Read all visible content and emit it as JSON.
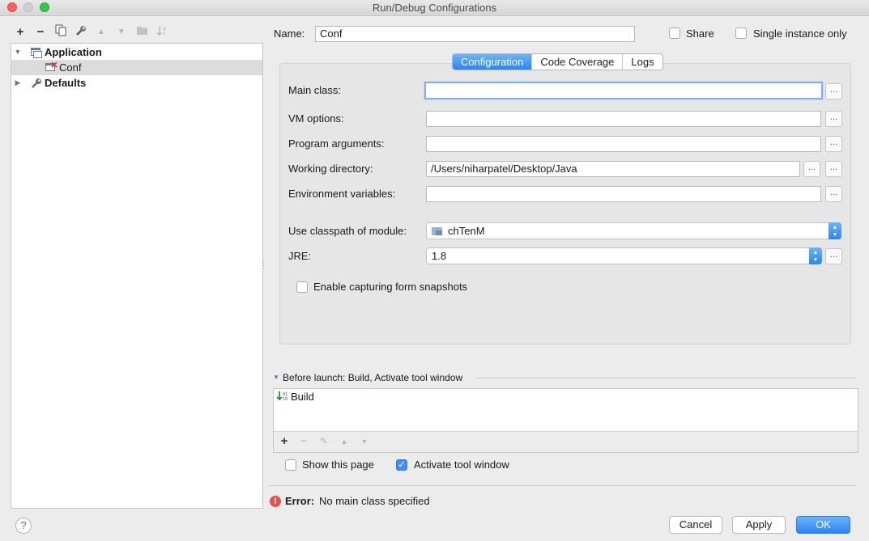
{
  "window": {
    "title": "Run/Debug Configurations"
  },
  "toolbar": {
    "items": [
      {
        "icon": "plus-icon",
        "glyph": "+"
      },
      {
        "icon": "minus-icon",
        "glyph": "−"
      },
      {
        "icon": "copy-icon",
        "glyph": "⧉"
      },
      {
        "icon": "wrench-icon",
        "glyph": "🔧"
      },
      {
        "icon": "arrow-up-icon",
        "glyph": "▲"
      },
      {
        "icon": "arrow-down-icon",
        "glyph": "▼"
      },
      {
        "icon": "folder-icon",
        "glyph": "▬"
      },
      {
        "icon": "sort-icon",
        "glyph": "↓"
      }
    ]
  },
  "tree": {
    "application": "Application",
    "conf": "Conf",
    "defaults": "Defaults"
  },
  "header": {
    "name_label": "Name:",
    "name_value": "Conf",
    "share_label": "Share",
    "single_instance_label": "Single instance only"
  },
  "tabs": [
    "Configuration",
    "Code Coverage",
    "Logs"
  ],
  "form": {
    "main_class_label": "Main class:",
    "main_class_value": "",
    "vm_options_label": "VM options:",
    "vm_options_value": "",
    "program_args_label": "Program arguments:",
    "program_args_value": "",
    "working_dir_label": "Working directory:",
    "working_dir_value": "/Users/niharpatel/Desktop/Java",
    "env_vars_label": "Environment variables:",
    "env_vars_value": "",
    "classpath_label": "Use classpath of module:",
    "classpath_value": "chTenM",
    "jre_label": "JRE:",
    "jre_value": "1.8",
    "snapshots_label": "Enable capturing form snapshots",
    "dots": "..."
  },
  "before_launch": {
    "title": "Before launch: Build, Activate tool window",
    "items": [
      "Build"
    ]
  },
  "options": {
    "show_page_label": "Show this page",
    "activate_tool_label": "Activate tool window"
  },
  "error": {
    "prefix": "Error:",
    "message": "No main class specified"
  },
  "buttons": {
    "help": "?",
    "cancel": "Cancel",
    "apply": "Apply",
    "ok": "OK"
  },
  "colors": {
    "accent": "#2b84f2",
    "error": "#e55252"
  }
}
